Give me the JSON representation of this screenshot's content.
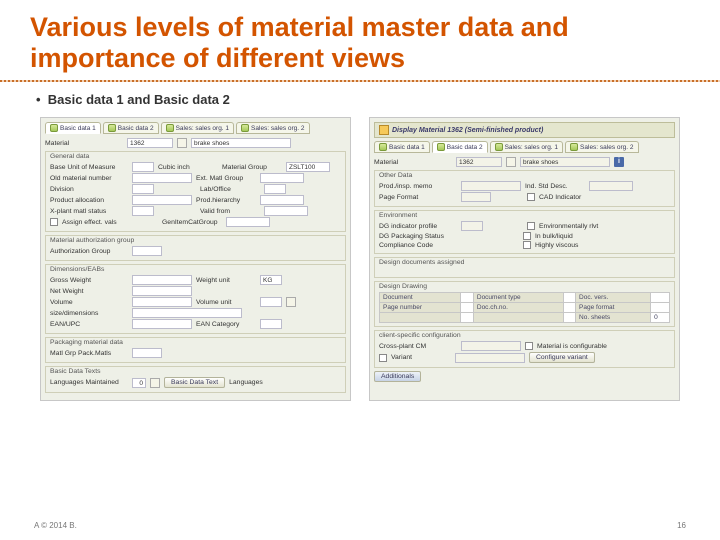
{
  "title": "Various levels of material master data and importance of different views",
  "bullet": "Basic data 1 and Basic data 2",
  "footer_left": "A © 2014 B.",
  "footer_right": "16",
  "left": {
    "header": "",
    "tabs": [
      "Basic data 1",
      "Basic data 2",
      "Sales: sales org. 1",
      "Sales: sales org. 2"
    ],
    "material_lbl": "Material",
    "material_val": "1362",
    "material_desc": "brake shoes",
    "s_general": "General data",
    "uom_lbl": "Base Unit of Measure",
    "uom_val": "",
    "uom_text": "Cubic inch",
    "matgrp_lbl": "Material Group",
    "matgrp_val": "ZSLT100",
    "oldmat_lbl": "Old material number",
    "extmat_lbl": "Ext. Matl Group",
    "division_lbl": "Division",
    "lab_lbl": "Lab/Office",
    "prodalloc_lbl": "Product allocation",
    "prodhier_lbl": "Prod.hierarchy",
    "xplant_lbl": "X-plant matl status",
    "valid_lbl": "Valid from",
    "assign_lbl": "Assign effect. vals",
    "genitem_lbl": "GenItemCatGroup",
    "s_auth": "Material authorization group",
    "authgrp_lbl": "Authorization Group",
    "s_dim": "Dimensions/EABs",
    "gross_lbl": "Gross Weight",
    "wunit_lbl": "Weight unit",
    "wunit_val": "KG",
    "net_lbl": "Net Weight",
    "vol_lbl": "Volume",
    "vunit_lbl": "Volume unit",
    "size_lbl": "size/dimensions",
    "ean_lbl": "EAN/UPC",
    "eancat_lbl": "EAN Category",
    "s_pack": "Packaging material data",
    "matgrp2_lbl": "Matl Grp Pack.Matls",
    "s_bdt": "Basic Data Texts",
    "lang_lbl": "Languages Maintained",
    "lang_val": "0",
    "bdt_btn": "Basic Data Text",
    "lang2_lbl": "Languages"
  },
  "right": {
    "header": "Display Material 1362 (Semi-finished product)",
    "tabs": [
      "Basic data 1",
      "Basic data 2",
      "Sales: sales org. 1",
      "Sales: sales org. 2"
    ],
    "material_lbl": "Material",
    "material_val": "1362",
    "material_desc": "brake shoes",
    "s_other": "Other Data",
    "stor_lbl": "Prod./insp. memo",
    "stor2_lbl": "Ind. Std Desc.",
    "page_lbl": "Page Format",
    "cad_lbl": "CAD Indicator",
    "s_env": "Environment",
    "dgind_lbl": "DG indicator profile",
    "envrel_lbl": "Environmentally rlvt",
    "dgpack_lbl": "DG Packaging Status",
    "bulk_lbl": "In bulk/liquid",
    "compl_lbl": "Compliance Code",
    "visc_lbl": "Highly viscous",
    "s_design": "Design documents assigned",
    "s_draw": "Design Drawing",
    "docnum_lbl": "Document",
    "doctype_lbl": "Document type",
    "docver_lbl": "Doc. vers.",
    "pagenum_lbl": "Page number",
    "docch_lbl": "Doc.ch.no.",
    "pagefmt_lbl": "Page format",
    "sheets_lbl": "No. sheets",
    "sheets_val": "0",
    "s_client": "client-specific configuration",
    "crossplant_lbl": "Cross-plant CM",
    "matconf_lbl": "Material is configurable",
    "variant_lbl": "Variant",
    "confvar_btn": "Configure variant",
    "add_btn": "Additionals"
  }
}
